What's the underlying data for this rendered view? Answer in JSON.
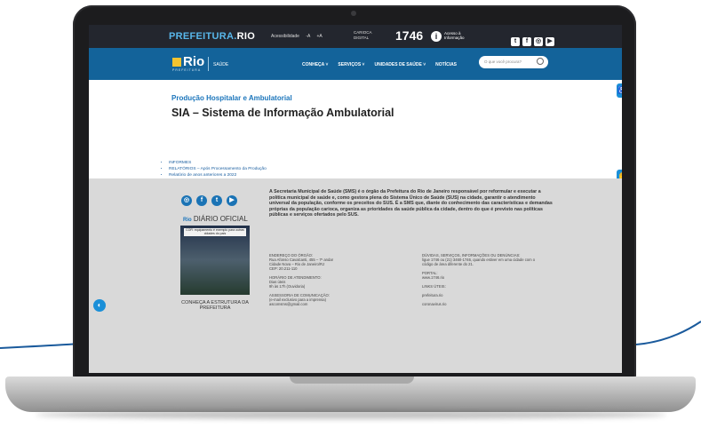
{
  "colors": {
    "topbar": "#23262e",
    "navbar": "#13639a",
    "accent": "#1b75bb",
    "footer": "#d9d9d9"
  },
  "topbar": {
    "brand_main": "PREFEITURA.",
    "brand_suffix": "RIO",
    "acessibilidade": "Acessibilidade",
    "font_minus": "-A",
    "font_plus": "+A",
    "carioca_digital": "CARIOCA DIGITAL",
    "number_1746": "1746",
    "acesso_informacao": "Acesso à Informação",
    "social_icons": [
      "twitter-icon",
      "facebook-icon",
      "instagram-icon",
      "youtube-icon"
    ]
  },
  "navbar": {
    "logo_text": "Rio",
    "logo_subtitle": "PREFEITURA",
    "section": "SAÚDE",
    "menu": [
      "CONHEÇA ˅",
      "SERVIÇOS ˅",
      "UNIDADES DE SAÚDE ˅",
      "NOTÍCIAS"
    ],
    "search_placeholder": "O que você procura?"
  },
  "content": {
    "subtitle": "Produção Hospitalar e Ambulatorial",
    "title": "SIA – Sistema de Informação Ambulatorial",
    "links": [
      "INFORMES",
      "RELATÓRIOS – Após Processamento da Produção",
      "Relatório de anos anteriores a 2022"
    ]
  },
  "footer": {
    "diario_prefix": "Rio",
    "diario_title": "DIÁRIO OFICIAL",
    "diario_headline": "COR: equipamento é exemplo para outras cidades do país",
    "estrutura_link": "CONHEÇA A ESTRUTURA DA PREFEITURA",
    "about": "A Secretaria Municipal de Saúde (SMS) é o órgão da Prefeitura do Rio de Janeiro responsável por reformular e executar a política municipal de saúde e, como gestora plena do Sistema Único de Saúde (SUS) na cidade, garantir o atendimento universal da população, conforme os preceitos do SUS. É a SMS que, diante do conhecimento das características e demandas próprias da população carioca, organiza as prioridades da saúde pública da cidade, dentro do que é previsto nas políticas públicas e serviços ofertados pelo SUS.",
    "endereco_label": "ENDEREÇO DO ÓRGÃO:",
    "endereco_line1": "Rua Afonso Cavalcanti, 455 – 7º andar",
    "endereco_line2": "Cidade Nova – Rio de Janeiro/RJ",
    "endereco_cep": "CEP: 20.211-110",
    "horario_label": "HORÁRIO DE ATENDIMENTO:",
    "horario_line1": "Dias úteis",
    "horario_line2": "9h às 17h (Ouvidoria)",
    "assessoria_label": "ASSESSORIA DE COMUNICAÇÃO:",
    "assessoria_line1": "(e-mail exclusivo para a imprensa)",
    "assessoria_email": "ascomsms@gmail.com",
    "duvidas_label": "DÚVIDAS, SERVIÇOS, INFORMAÇÕES OU DENÚNCIAS:",
    "duvidas_line1": "ligue 1746 ou (21) 3460-1746, quando estiver em uma cidade com o",
    "duvidas_line2": "código de área diferente do 21.",
    "portal_label": "PORTAL:",
    "portal_value": "www.1746.rio",
    "links_uteis_label": "LINKS ÚTEIS:",
    "link_prefeitura": "prefeitura.rio",
    "link_coronavirus": "coronavirus.rio",
    "social_icons": [
      "instagram-icon",
      "facebook-icon",
      "twitter-icon",
      "youtube-icon"
    ]
  }
}
